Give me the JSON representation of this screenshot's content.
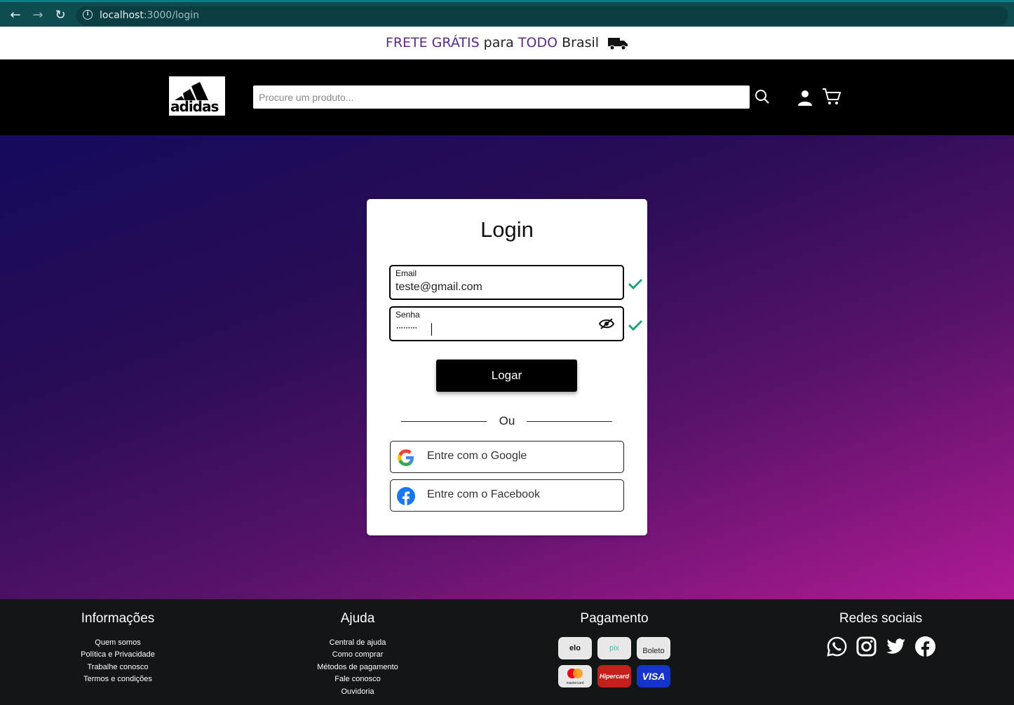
{
  "browser": {
    "url_host": "localhost",
    "url_rest": ":3000/login"
  },
  "promo": {
    "part1": "FRETE GRÁTIS",
    "part2": "para",
    "part3": "TODO",
    "part4": "Brasil"
  },
  "header": {
    "logo_text": "adidas",
    "search_placeholder": "Procure um produto..."
  },
  "login": {
    "title": "Login",
    "email_label": "Email",
    "email_value": "teste@gmail.com",
    "password_label": "Senha",
    "password_value": "·········",
    "submit_label": "Logar",
    "divider_text": "Ou",
    "google_label": "Entre com o Google",
    "facebook_label": "Entre com o Facebook"
  },
  "footer": {
    "info": {
      "title": "Informações",
      "links": [
        "Quem somos",
        "Política e Privacidade",
        "Trabalhe conosco",
        "Termos e condições"
      ]
    },
    "help": {
      "title": "Ajuda",
      "links": [
        "Central de ajuda",
        "Como comprar",
        "Métodos de pagamento",
        "Fale conosco",
        "Ouvidoria"
      ]
    },
    "payment": {
      "title": "Pagamento",
      "methods": [
        "elo",
        "pix",
        "Boleto",
        "mastercard",
        "Hipercard",
        "VISA"
      ]
    },
    "social": {
      "title": "Redes sociais",
      "icons": [
        "whatsapp-icon",
        "instagram-icon",
        "twitter-icon",
        "facebook-icon"
      ]
    }
  },
  "colors": {
    "accent_purple": "#5b2a86",
    "check_green": "#1fa37a",
    "browser_teal": "#0f4c52"
  }
}
